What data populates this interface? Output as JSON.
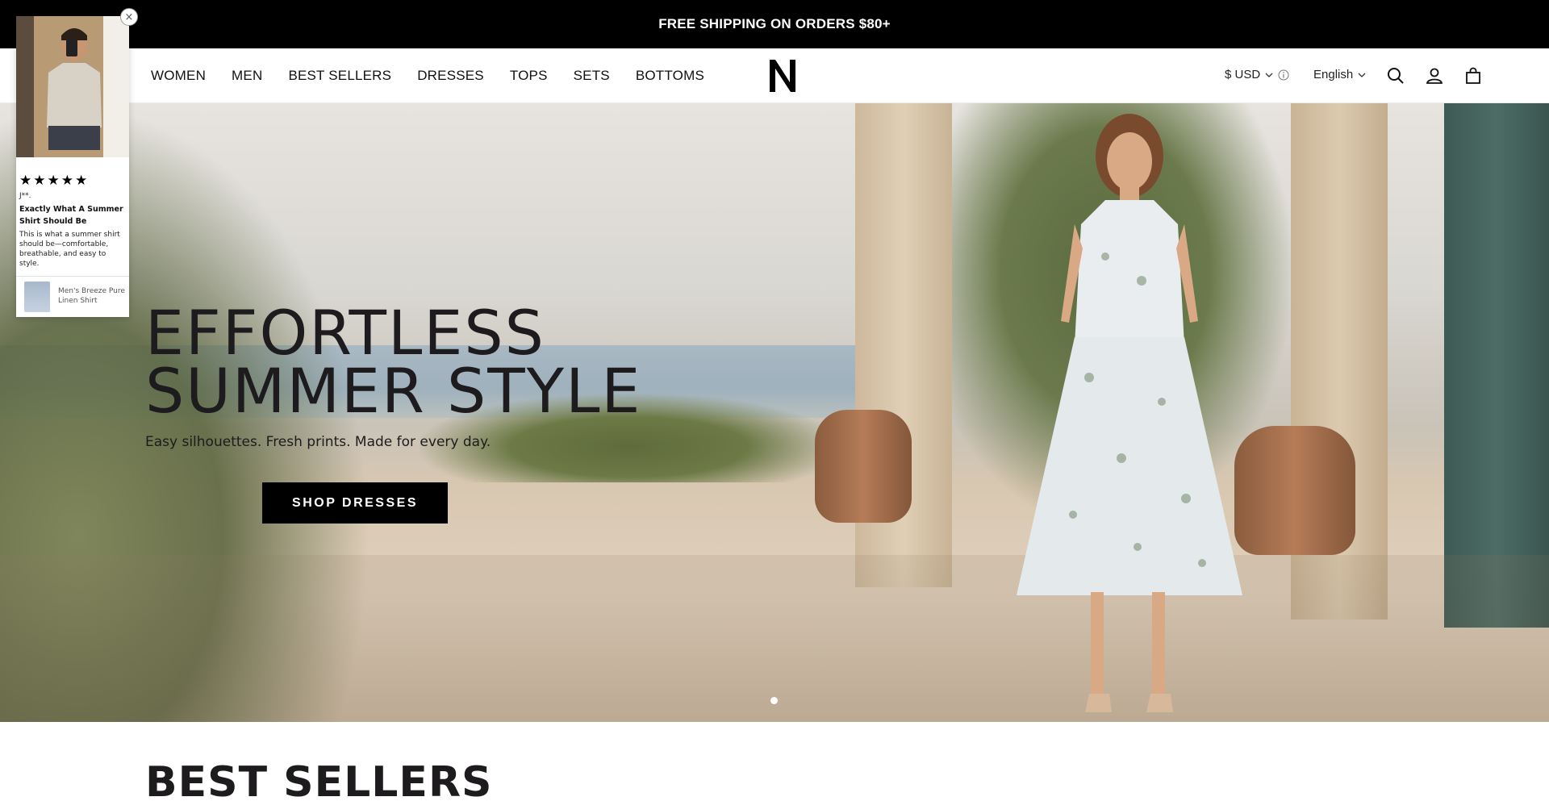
{
  "announcement": {
    "text": "FREE SHIPPING ON ORDERS $80+"
  },
  "nav": {
    "items": [
      {
        "label": "WOMEN"
      },
      {
        "label": "MEN"
      },
      {
        "label": "BEST SELLERS"
      },
      {
        "label": "DRESSES"
      },
      {
        "label": "TOPS"
      },
      {
        "label": "SETS"
      },
      {
        "label": "BOTTOMS"
      }
    ]
  },
  "header": {
    "logo_icon": "n-logo-icon",
    "currency": "$ USD",
    "language": "English",
    "icons": [
      "search-icon",
      "account-icon",
      "cart-icon"
    ]
  },
  "hero": {
    "title_line1": "EFFORTLESS",
    "title_line2": "SUMMER STYLE",
    "subtitle": "Easy silhouettes. Fresh prints. Made for every day.",
    "cta": "SHOP DRESSES"
  },
  "section": {
    "best_sellers_title": "BEST SELLERS"
  },
  "review_popup": {
    "stars": 5,
    "reviewer": "J**.",
    "title": "Exactly What A Summer Shirt Should Be",
    "body": "This is what a summer shirt should be—comfortable, breathable, and easy to style.",
    "product": "Men's Breeze Pure Linen Shirt",
    "close_symbol": "×"
  },
  "colors": {
    "announcement_bg": "#000000",
    "cta_bg": "#000000",
    "text": "#1d1b1d"
  }
}
